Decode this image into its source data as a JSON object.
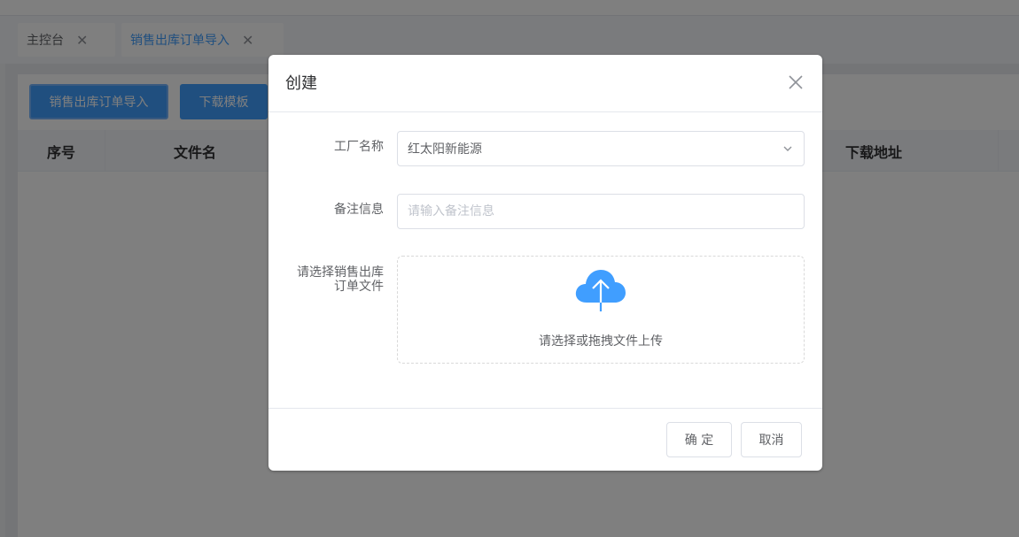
{
  "tabs": [
    {
      "label": "主控台",
      "active": false
    },
    {
      "label": "销售出库订单导入",
      "active": true
    }
  ],
  "toolbar": {
    "import_label": "销售出库订单导入",
    "template_label": "下载模板"
  },
  "table": {
    "columns": [
      "序号",
      "文件名",
      "下载地址"
    ]
  },
  "dialog": {
    "title": "创建",
    "factory_label": "工厂名称",
    "factory_value": "红太阳新能源",
    "remark_label": "备注信息",
    "remark_placeholder": "请输入备注信息",
    "file_label_line1": "请选择销售出库",
    "file_label_line2": "订单文件",
    "upload_text": "请选择或拖拽文件上传",
    "confirm_label": "确 定",
    "cancel_label": "取消"
  },
  "colors": {
    "primary": "#409eff",
    "upload_icon": "#409eff"
  }
}
